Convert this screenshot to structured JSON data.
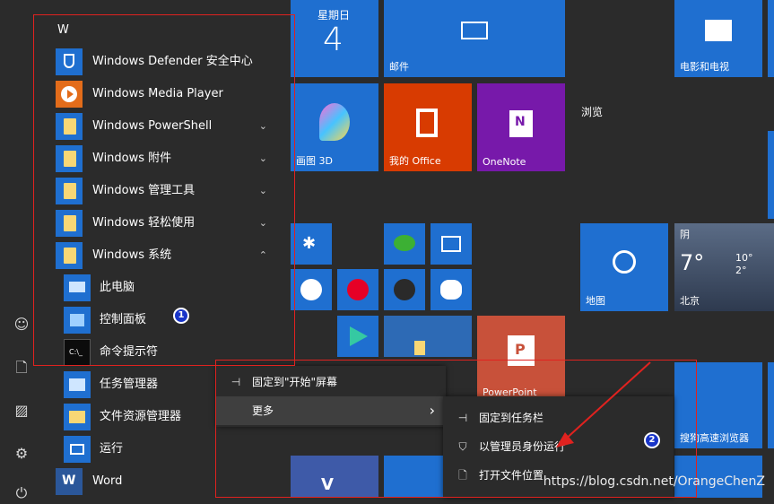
{
  "applist": {
    "section_letter": "W",
    "items": [
      {
        "label": "Windows Defender 安全中心",
        "chevron": ""
      },
      {
        "label": "Windows Media Player",
        "chevron": ""
      },
      {
        "label": "Windows PowerShell",
        "chevron": "⌄"
      },
      {
        "label": "Windows 附件",
        "chevron": "⌄"
      },
      {
        "label": "Windows 管理工具",
        "chevron": "⌄"
      },
      {
        "label": "Windows 轻松使用",
        "chevron": "⌄"
      },
      {
        "label": "Windows 系统",
        "chevron": "⌃"
      }
    ],
    "subitems": [
      {
        "label": "此电脑"
      },
      {
        "label": "控制面板"
      },
      {
        "label": "命令提示符"
      },
      {
        "label": "任务管理器"
      },
      {
        "label": "文件资源管理器"
      },
      {
        "label": "运行"
      }
    ],
    "word": {
      "label": "Word"
    }
  },
  "tiles": {
    "calendar": {
      "day": "星期日",
      "date": "4"
    },
    "mail": {
      "label": "邮件"
    },
    "movies": {
      "label": "电影和电视"
    },
    "paint3d": {
      "label": "画图 3D"
    },
    "myoffice": {
      "label": "我的 Office"
    },
    "onenote": {
      "label": "OneNote"
    },
    "browse": {
      "label": "浏览"
    },
    "maps": {
      "label": "地图"
    },
    "weather": {
      "cond": "阴",
      "temp": "7°",
      "hi": "10°",
      "lo": "2°",
      "city": "北京"
    },
    "powerpoint": {
      "label": "PowerPoint"
    },
    "sogou": {
      "label": "搜狗高速浏览器"
    }
  },
  "menu1": {
    "items": [
      {
        "icon": "⊣",
        "label": "固定到\"开始\"屏幕"
      },
      {
        "icon": "",
        "label": "更多",
        "arrow": "›"
      }
    ]
  },
  "menu2": {
    "items": [
      {
        "icon": "⊣",
        "label": "固定到任务栏"
      },
      {
        "icon": "⛉",
        "label": "以管理员身份运行"
      },
      {
        "icon": "🗋",
        "label": "打开文件位置"
      }
    ]
  },
  "annotations": {
    "badge1": "1",
    "badge2": "2"
  },
  "watermark": "https://blog.csdn.net/OrangeChenZ",
  "colors": {
    "accent": "#1f6fd0",
    "annotation": "#e0221f",
    "office": "#d83b01",
    "onenote": "#7719aa",
    "powerpoint": "#c8513a"
  }
}
